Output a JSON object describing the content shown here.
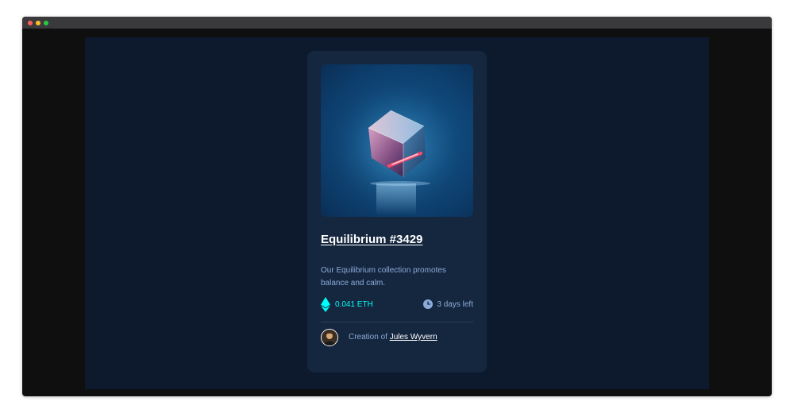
{
  "card": {
    "title": "Equilibrium #3429",
    "description": "Our Equilibrium collection promotes balance and calm.",
    "price": "0.041 ETH",
    "time_left": "3 days left",
    "creator_prefix": "Creation of",
    "creator_name": "Jules Wyvern"
  },
  "icons": {
    "art": "equilibrium-cube-image",
    "currency": "ethereum-icon",
    "time": "clock-icon",
    "avatar": "creator-avatar"
  },
  "colors": {
    "page_bg": "#0d1a2e",
    "card_bg": "#15263f",
    "accent_cyan": "#00fff8",
    "soft_blue": "#8bacd9",
    "white": "#ffffff"
  }
}
